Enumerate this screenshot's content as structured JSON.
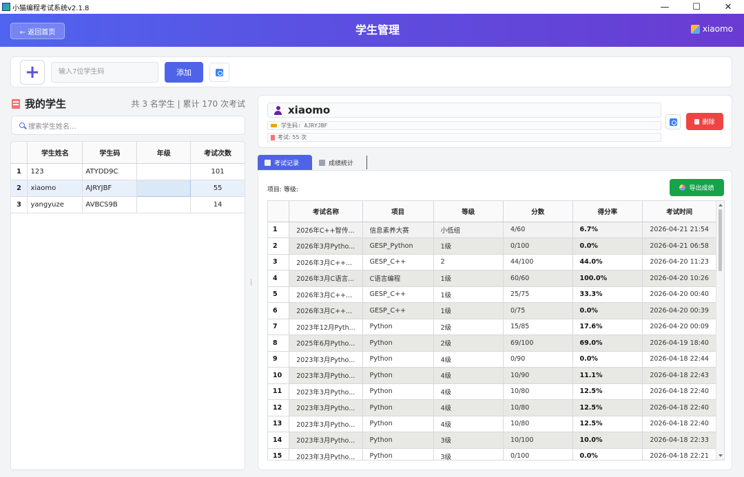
{
  "window": {
    "title": "小猫编程考试系统v2.1.8",
    "controls": {
      "minimize": "—",
      "maximize": "☐",
      "close": "✕"
    }
  },
  "header": {
    "back_label": "← 返回首页",
    "title": "学生管理",
    "user": "xiaomo"
  },
  "addbar": {
    "plus": "+",
    "code_placeholder": "输入7位学生码",
    "add_label": "添加"
  },
  "students": {
    "title": "我的学生",
    "stats": "共 3 名学生 | 累计 170 次考试",
    "search_placeholder": "搜索学生姓名...",
    "columns": [
      "学生姓名",
      "学生码",
      "年级",
      "考试次数"
    ],
    "rows": [
      {
        "no": "1",
        "name": "123",
        "code": "ATYDD9C",
        "grade": "",
        "count": "101"
      },
      {
        "no": "2",
        "name": "xiaomo",
        "code": "AJRYJBF",
        "grade": "",
        "count": "55"
      },
      {
        "no": "3",
        "name": "yangyuze",
        "code": "AVBCS9B",
        "grade": "",
        "count": "14"
      }
    ],
    "selected_index": 1
  },
  "detail": {
    "name": "xiaomo",
    "code_line": "学生码: AJRYJBF",
    "exam_line": "考试: 55 次",
    "delete_label": "删除"
  },
  "tabs": [
    {
      "label": "考试记录",
      "active": true
    },
    {
      "label": "成绩统计",
      "active": false
    }
  ],
  "records": {
    "filter_text": "项目: 等级:",
    "export_label": "导出成绩",
    "columns": [
      "考试名称",
      "项目",
      "等级",
      "分数",
      "得分率",
      "考试时间"
    ],
    "rows": [
      {
        "no": "1",
        "name": "2026年C++智传...",
        "project": "信息素养大赛",
        "level": "小低组",
        "score": "4/60",
        "rate": "6.7%",
        "time": "2026-04-21 21:54"
      },
      {
        "no": "2",
        "name": "2026年3月Pytho...",
        "project": "GESP_Python",
        "level": "1级",
        "score": "0/100",
        "rate": "0.0%",
        "time": "2026-04-21 06:58"
      },
      {
        "no": "3",
        "name": "2026年3月C++...",
        "project": "GESP_C++",
        "level": "2",
        "score": "44/100",
        "rate": "44.0%",
        "time": "2026-04-20 11:23"
      },
      {
        "no": "4",
        "name": "2026年3月C语言...",
        "project": "C语言编程",
        "level": "1级",
        "score": "60/60",
        "rate": "100.0%",
        "time": "2026-04-20 10:26"
      },
      {
        "no": "5",
        "name": "2026年3月C++...",
        "project": "GESP_C++",
        "level": "1级",
        "score": "25/75",
        "rate": "33.3%",
        "time": "2026-04-20 00:40"
      },
      {
        "no": "6",
        "name": "2026年3月C++...",
        "project": "GESP_C++",
        "level": "1级",
        "score": "0/75",
        "rate": "0.0%",
        "time": "2026-04-20 00:39"
      },
      {
        "no": "7",
        "name": "2023年12月Pyth...",
        "project": "Python",
        "level": "2级",
        "score": "15/85",
        "rate": "17.6%",
        "time": "2026-04-20 00:09"
      },
      {
        "no": "8",
        "name": "2025年6月Pytho...",
        "project": "Python",
        "level": "2级",
        "score": "69/100",
        "rate": "69.0%",
        "time": "2026-04-19 18:40"
      },
      {
        "no": "9",
        "name": "2023年3月Pytho...",
        "project": "Python",
        "level": "4级",
        "score": "0/90",
        "rate": "0.0%",
        "time": "2026-04-18 22:44"
      },
      {
        "no": "10",
        "name": "2023年3月Pytho...",
        "project": "Python",
        "level": "4级",
        "score": "10/90",
        "rate": "11.1%",
        "time": "2026-04-18 22:43"
      },
      {
        "no": "11",
        "name": "2023年3月Pytho...",
        "project": "Python",
        "level": "4级",
        "score": "10/80",
        "rate": "12.5%",
        "time": "2026-04-18 22:40"
      },
      {
        "no": "12",
        "name": "2023年3月Pytho...",
        "project": "Python",
        "level": "4级",
        "score": "10/80",
        "rate": "12.5%",
        "time": "2026-04-18 22:40"
      },
      {
        "no": "13",
        "name": "2023年3月Pytho...",
        "project": "Python",
        "level": "4级",
        "score": "10/80",
        "rate": "12.5%",
        "time": "2026-04-18 22:40"
      },
      {
        "no": "14",
        "name": "2023年3月Pytho...",
        "project": "Python",
        "level": "3级",
        "score": "10/100",
        "rate": "10.0%",
        "time": "2026-04-18 22:33"
      },
      {
        "no": "15",
        "name": "2023年3月Pytho...",
        "project": "Python",
        "level": "3级",
        "score": "0/100",
        "rate": "0.0%",
        "time": "2026-04-18 22:21"
      }
    ]
  },
  "colors": {
    "header_start": "#4f64ef",
    "header_end": "#6a3bd2",
    "primary": "#4f63e8",
    "danger": "#ef4444",
    "success": "#16a34a"
  }
}
